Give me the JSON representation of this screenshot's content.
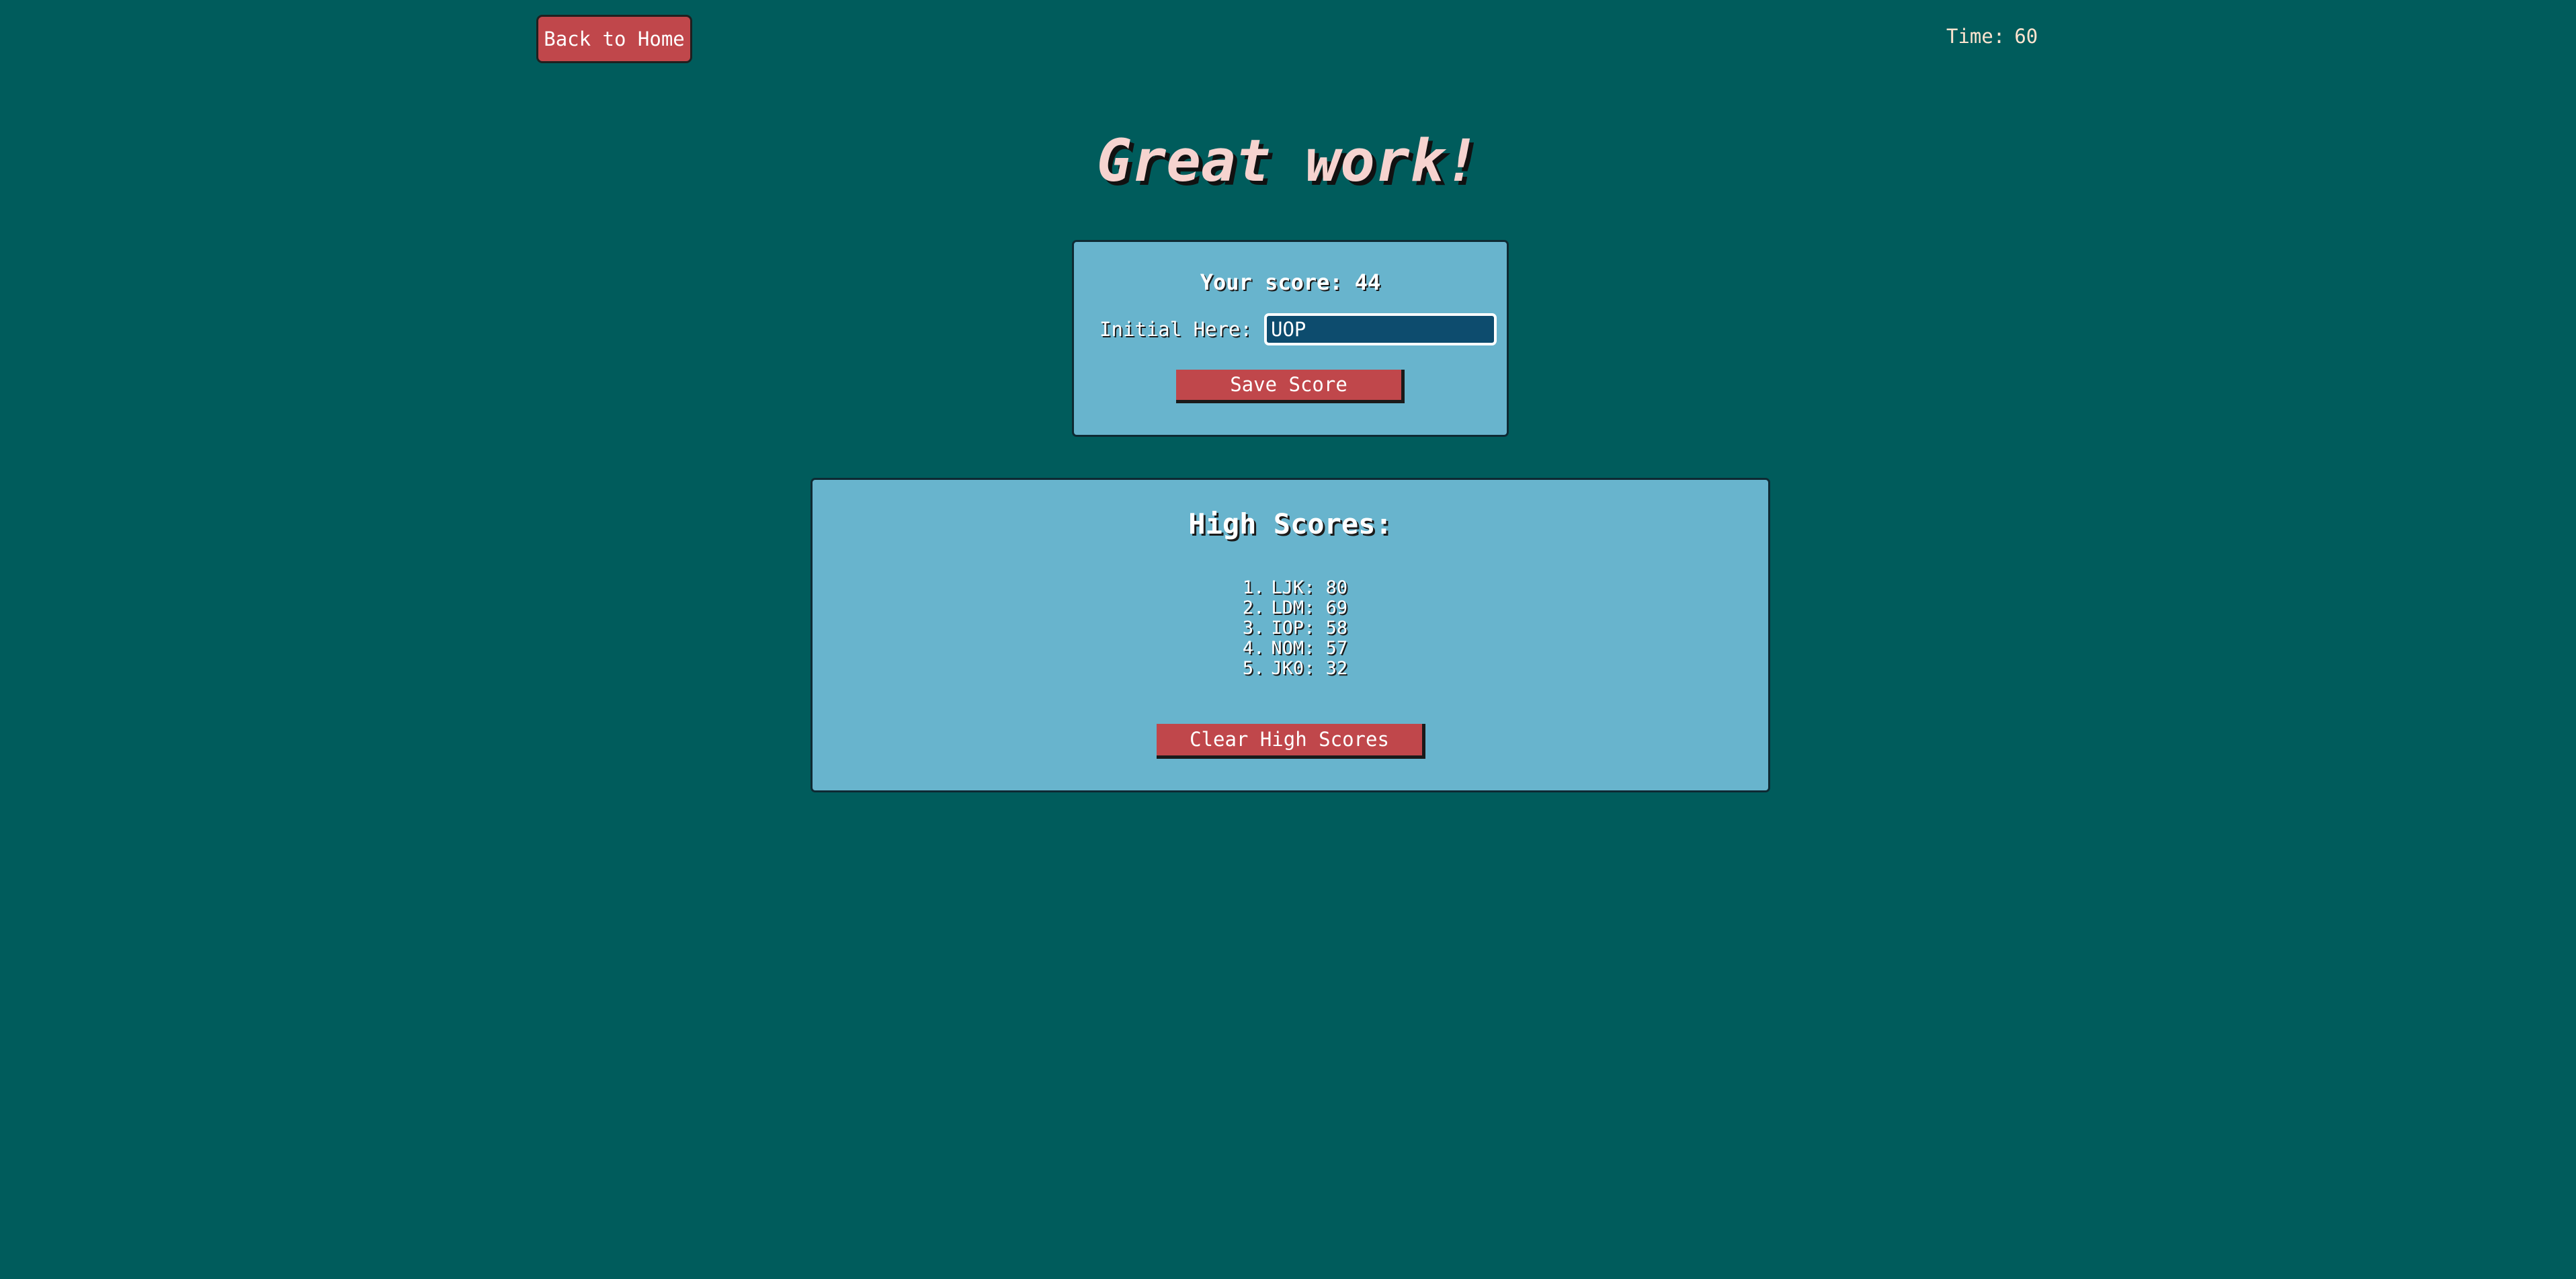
{
  "header": {
    "home_button_label": "Back to Home",
    "timer_label": "Time:",
    "timer_value": "60"
  },
  "result": {
    "headline": "Great work!"
  },
  "score_form": {
    "score_label": "Your score:",
    "score_value": "44",
    "initial_label": "Initial Here:",
    "initial_value": "UOP",
    "save_button_label": "Save Score"
  },
  "high_scores": {
    "title": "High Scores:",
    "entries": [
      {
        "rank": "1.",
        "text": "LJK: 80"
      },
      {
        "rank": "2.",
        "text": "LDM: 69"
      },
      {
        "rank": "3.",
        "text": "IOP: 58"
      },
      {
        "rank": "4.",
        "text": "NOM: 57"
      },
      {
        "rank": "5.",
        "text": "JK0: 32"
      }
    ],
    "clear_button_label": "Clear High Scores"
  },
  "colors": {
    "background": "#005c5c",
    "card": "#68b4cd",
    "button": "#c0474b",
    "headline": "#f6d3cf",
    "input_background": "#0d4c6e"
  }
}
